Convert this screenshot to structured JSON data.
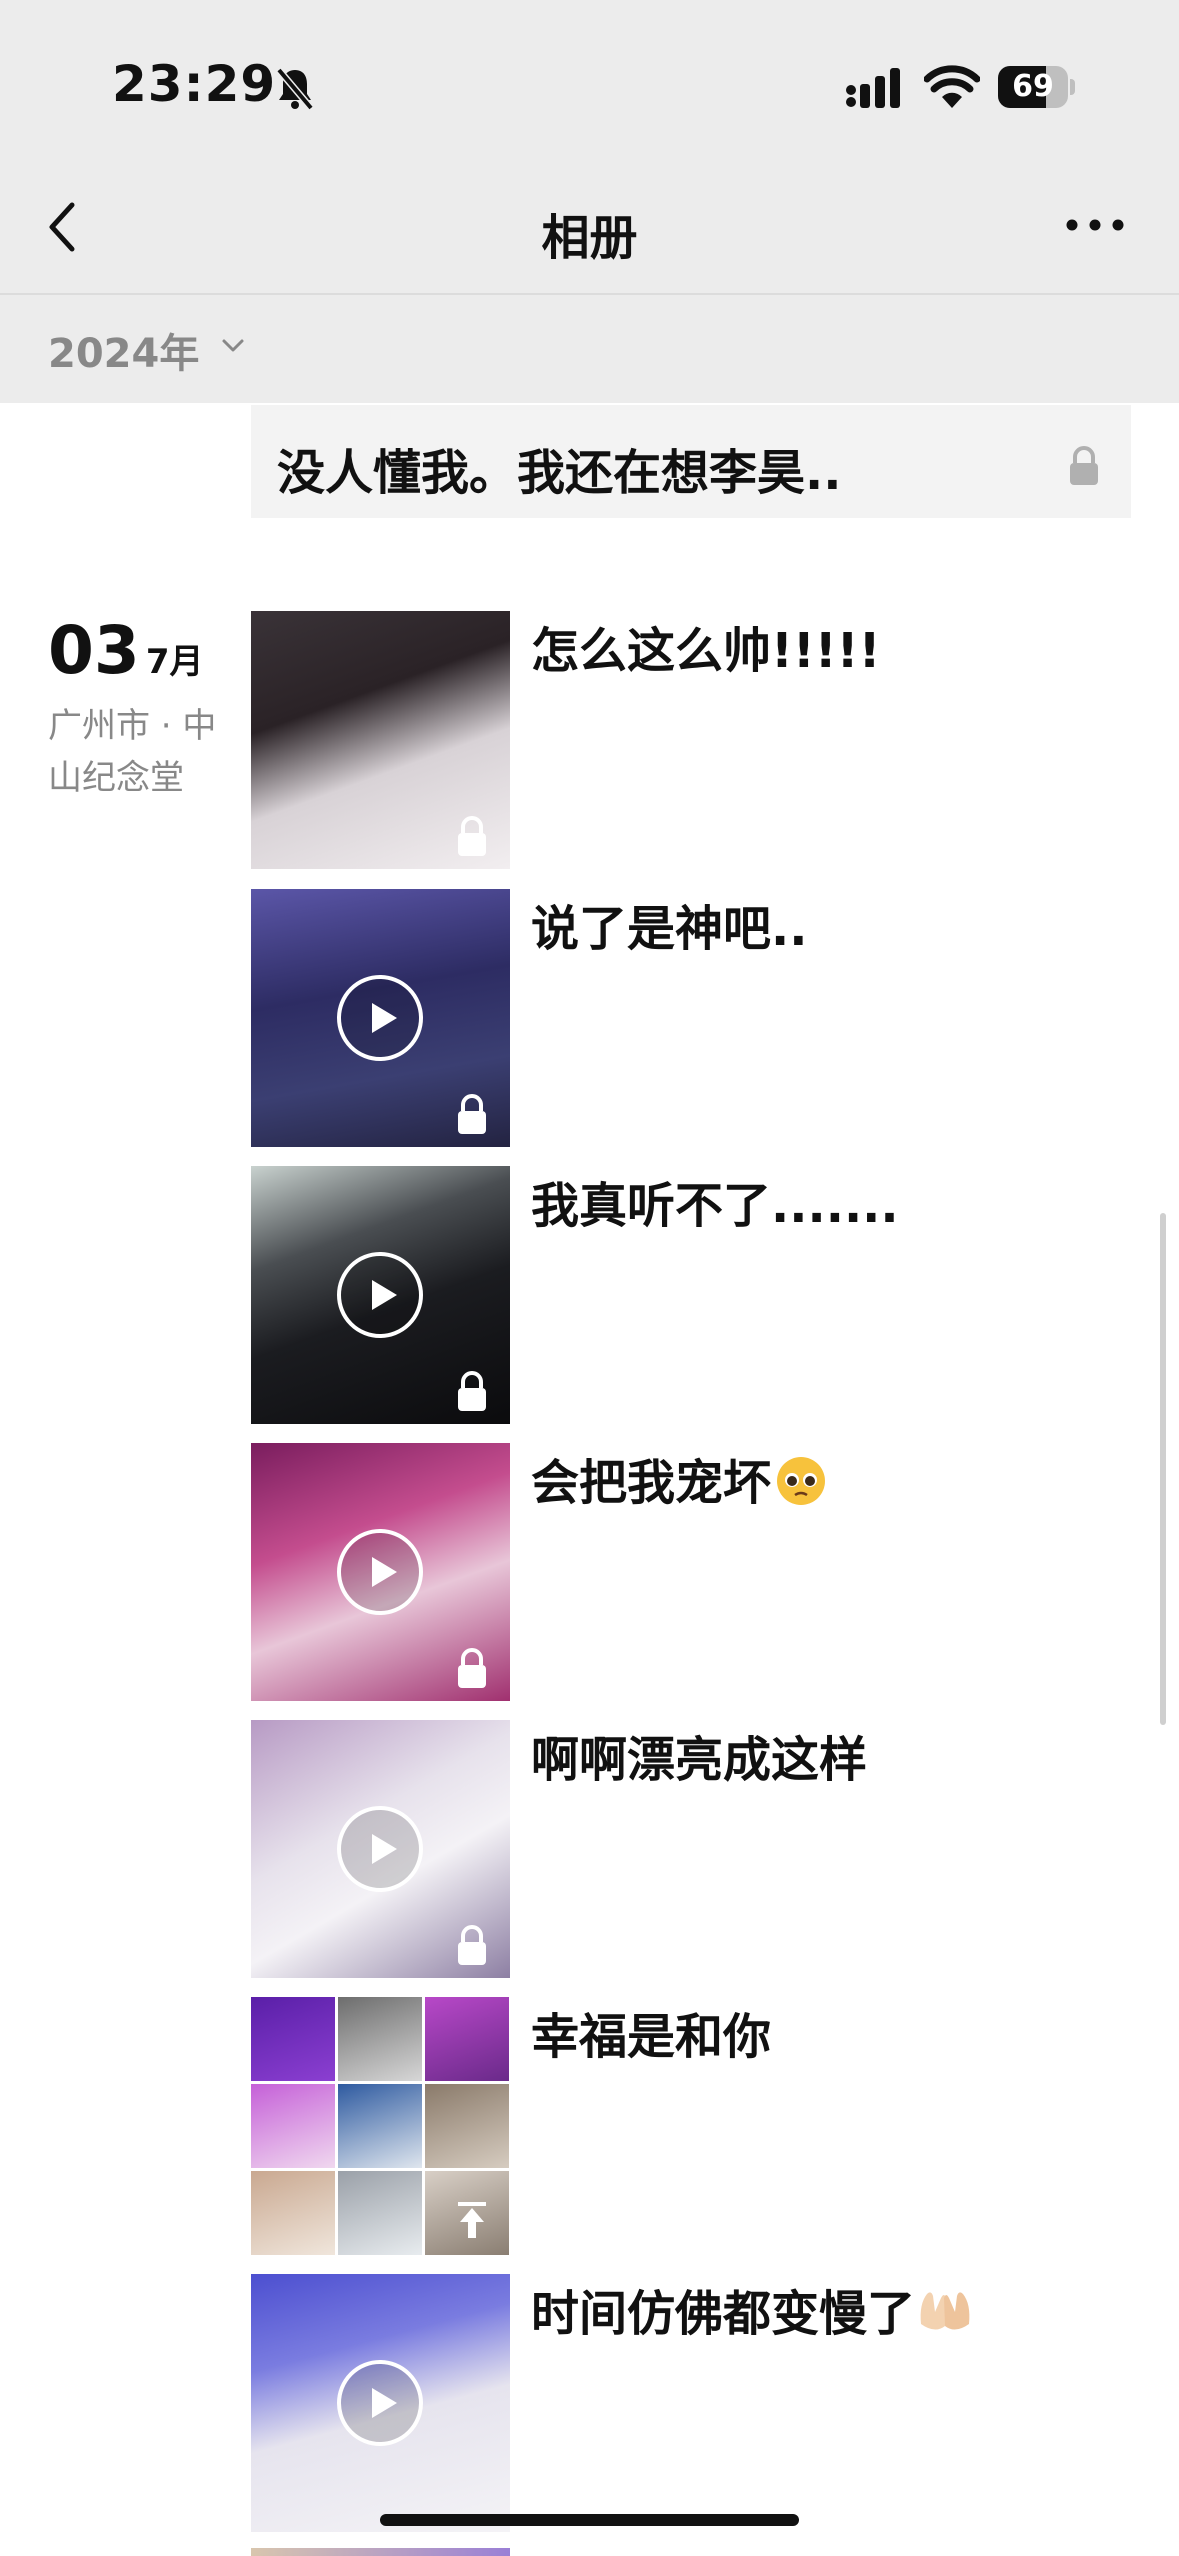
{
  "status": {
    "time": "23:29",
    "battery": "69",
    "battery_level": 0.69
  },
  "nav": {
    "title": "相册"
  },
  "year_filter": {
    "label": "2024年"
  },
  "text_post": {
    "text": "没人懂我。我还在想李昊.."
  },
  "date_group": {
    "day": "03",
    "month": "7月",
    "location": "广州市 · 中山纪念堂"
  },
  "posts": [
    {
      "caption": "怎么这么帅!!!!!",
      "type": "photo"
    },
    {
      "caption": "说了是神吧..",
      "type": "video"
    },
    {
      "caption": "我真听不了.......",
      "type": "video"
    },
    {
      "caption": "会把我宠坏",
      "emoji": "pleading-face",
      "type": "video"
    },
    {
      "caption": "啊啊漂亮成这样",
      "type": "video"
    },
    {
      "caption": "幸福是和你",
      "type": "album"
    },
    {
      "caption": "时间仿佛都变慢了",
      "emoji": "palms-up-together",
      "type": "video"
    }
  ],
  "colors": {
    "header_bg": "#ececec",
    "muted_text": "#888888",
    "text_card_bg": "#f3f3f3"
  }
}
